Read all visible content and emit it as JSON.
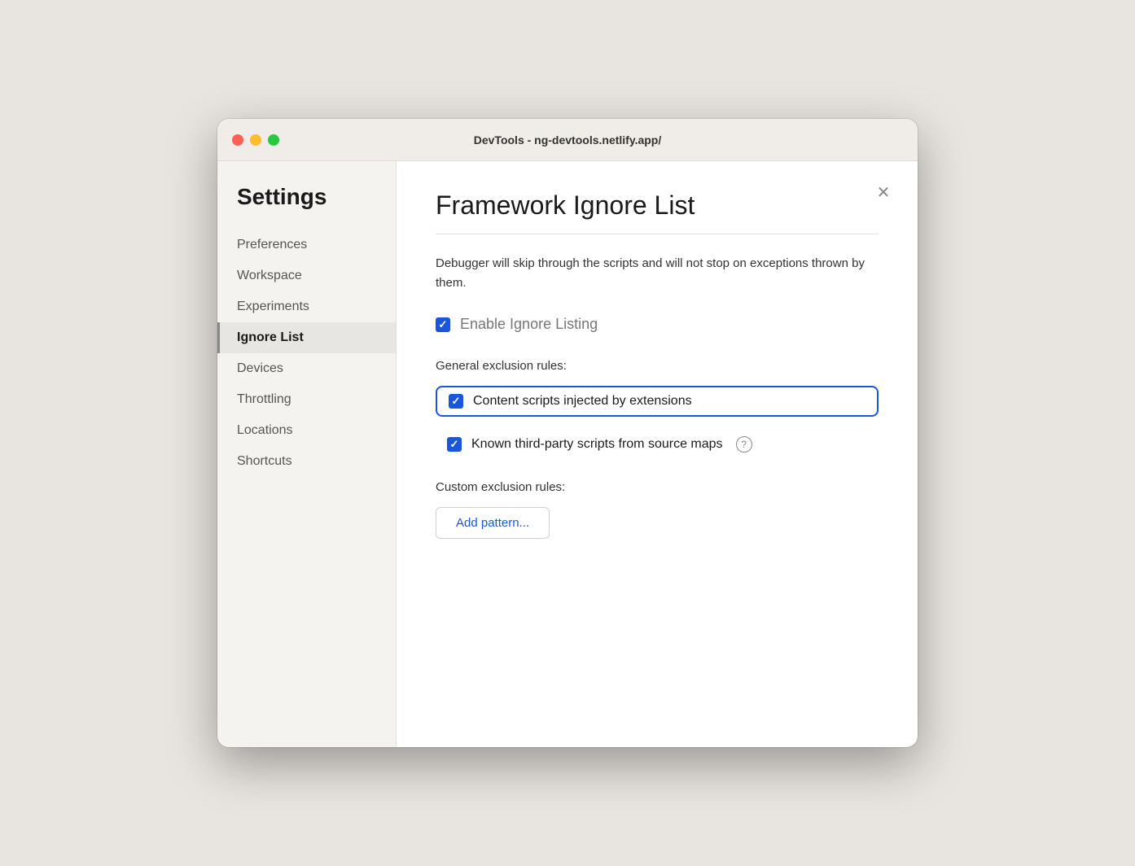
{
  "window": {
    "title": "DevTools - ng-devtools.netlify.app/"
  },
  "sidebar": {
    "heading": "Settings",
    "items": [
      {
        "id": "preferences",
        "label": "Preferences",
        "active": false
      },
      {
        "id": "workspace",
        "label": "Workspace",
        "active": false
      },
      {
        "id": "experiments",
        "label": "Experiments",
        "active": false
      },
      {
        "id": "ignore-list",
        "label": "Ignore List",
        "active": true
      },
      {
        "id": "devices",
        "label": "Devices",
        "active": false
      },
      {
        "id": "throttling",
        "label": "Throttling",
        "active": false
      },
      {
        "id": "locations",
        "label": "Locations",
        "active": false
      },
      {
        "id": "shortcuts",
        "label": "Shortcuts",
        "active": false
      }
    ]
  },
  "main": {
    "title": "Framework Ignore List",
    "description": "Debugger will skip through the scripts and will not stop on exceptions thrown by them.",
    "enable_ignore_label": "Enable Ignore Listing",
    "general_exclusion_label": "General exclusion rules:",
    "checkboxes": [
      {
        "id": "content-scripts",
        "label": "Content scripts injected by extensions",
        "checked": true,
        "highlighted": true,
        "has_help": false
      },
      {
        "id": "third-party-scripts",
        "label": "Known third-party scripts from source maps",
        "checked": true,
        "highlighted": false,
        "has_help": true
      }
    ],
    "custom_exclusion_label": "Custom exclusion rules:",
    "add_pattern_label": "Add pattern..."
  },
  "icons": {
    "close": "✕",
    "check": "✓",
    "question": "?"
  }
}
